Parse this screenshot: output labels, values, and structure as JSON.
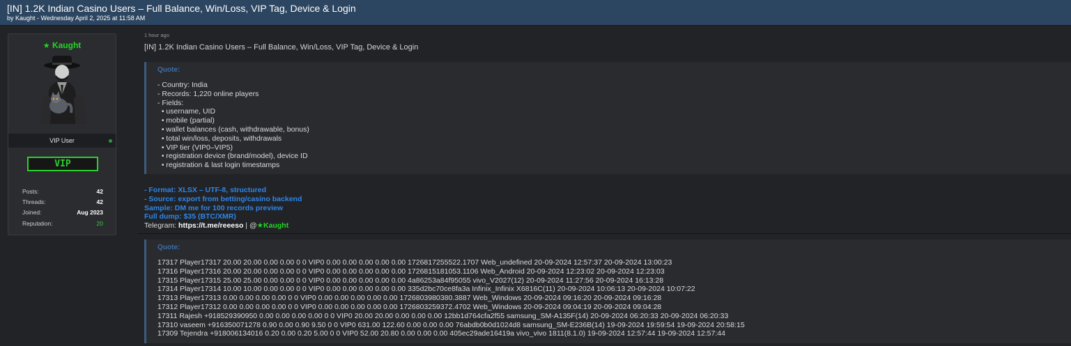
{
  "thread": {
    "title": "[IN] 1.2K Indian Casino Users – Full Balance, Win/Loss, VIP Tag, Device & Login",
    "byline": "by Kaught - Wednesday April 2, 2025 at 11:58 AM"
  },
  "user": {
    "name": "Kaught",
    "star": "★",
    "title": "VIP User",
    "badge": "VIP",
    "stats": [
      {
        "label": "Posts:",
        "value": "42"
      },
      {
        "label": "Threads:",
        "value": "42"
      },
      {
        "label": "Joined:",
        "value": "Aug 2023"
      },
      {
        "label": "Reputation:",
        "value": "20"
      }
    ]
  },
  "post": {
    "time": "1 hour ago",
    "title": "[IN] 1.2K Indian Casino Users – Full Balance, Win/Loss, VIP Tag, Device & Login"
  },
  "quote1": {
    "header": "Quote:",
    "lines": [
      "- Country: India",
      "- Records: 1,220 online players",
      "- Fields:",
      "  • username, UID",
      "  • mobile (partial)",
      "  • wallet balances (cash, withdrawable, bonus)",
      "  • total win/loss, deposits, withdrawals",
      "  • VIP tier (VIP0–VIP5)",
      "  • registration device (brand/model), device ID",
      "  • registration & last login timestamps"
    ]
  },
  "info": {
    "lines": [
      "- Format: XLSX – UTF-8, structured",
      "- Source: export from betting/casino backend",
      "Sample: DM me for 100 records preview",
      "Full dump: $35 (BTC/XMR)"
    ],
    "telegram_label": "Telegram: ",
    "telegram_link": "https://t.me/reeeso",
    "telegram_sep": " | @",
    "telegram_user": "Kaught"
  },
  "quote2": {
    "header": "Quote:",
    "lines": [
      "17317 Player17317 20.00 20.00 0.00 0.00 0 0 VIP0 0.00 0.00 0.00 0.00 0.00 1726817255522.1707 Web_undefined 20-09-2024 12:57:37 20-09-2024 13:00:23",
      "17316 Player17316 20.00 20.00 0.00 0.00 0 0 VIP0 0.00 0.00 0.00 0.00 0.00 1726815181053.1106 Web_Android 20-09-2024 12:23:02 20-09-2024 12:23:03",
      "17315 Player17315 25.00 25.00 0.00 0.00 0 0 VIP0 0.00 0.00 0.00 0.00 0.00 4a86253a84f95055 vivo_V2027(12) 20-09-2024 11:27:56 20-09-2024 16:13:28",
      "17314 Player17314 10.00 10.00 0.00 0.00 0 0 VIP0 0.00 0.00 0.00 0.00 0.00 335d2bc70ce8fa3a Infinix_Infinix X6816C(11) 20-09-2024 10:06:13 20-09-2024 10:07:22",
      "17313 Player17313 0.00 0.00 0.00 0.00 0 0 VIP0 0.00 0.00 0.00 0.00 0.00 1726803980380.3887 Web_Windows 20-09-2024 09:16:20 20-09-2024 09:16:28",
      "17312 Player17312 0.00 0.00 0.00 0.00 0 0 VIP0 0.00 0.00 0.00 0.00 0.00 1726803259372.4702 Web_Windows 20-09-2024 09:04:19 20-09-2024 09:04:28",
      "17311 Rajesh +918529390950 0.00 0.00 0.00 0.00 0 0 VIP0 20.00 20.00 0.00 0.00 0.00 12bb1d764cfa2f55 samsung_SM-A135F(14) 20-09-2024 06:20:33 20-09-2024 06:20:33",
      "17310 vaseem +916350071278 0.90 0.00 0.90 9.50 0 0 VIP0 631.00 122.60 0.00 0.00 0.00 76abdb0b0d1024d8 samsung_SM-E236B(14) 19-09-2024 19:59:54 19-09-2024 20:58:15",
      "17309 Tejendra +918006134016 0.20 0.00 0.20 5.00 0 0 VIP0 52.00 20.80 0.00 0.00 0.00 405ec29ade16419a vivo_vivo 1811(8.1.0) 19-09-2024 12:57:44 19-09-2024 12:57:44"
    ]
  }
}
